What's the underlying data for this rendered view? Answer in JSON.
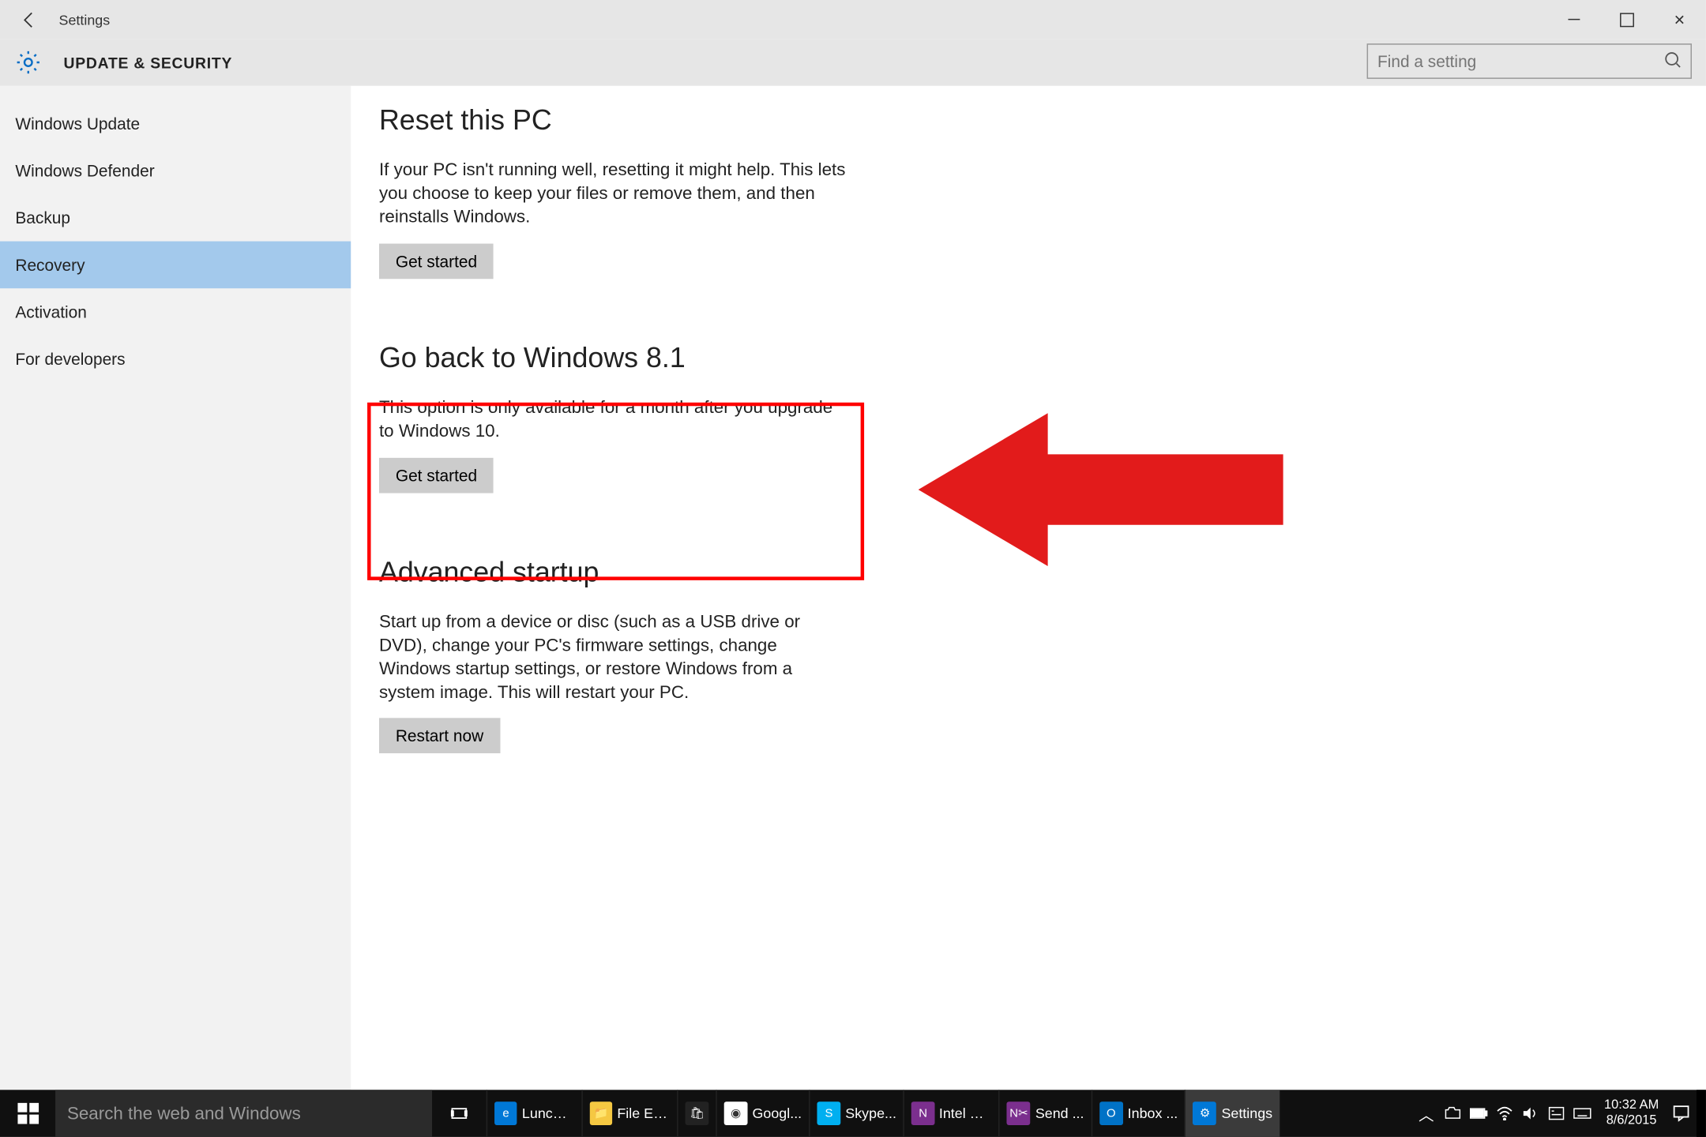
{
  "window": {
    "title": "Settings",
    "section": "UPDATE & SECURITY"
  },
  "search": {
    "placeholder": "Find a setting"
  },
  "sidebar": {
    "items": [
      {
        "label": "Windows Update",
        "active": false
      },
      {
        "label": "Windows Defender",
        "active": false
      },
      {
        "label": "Backup",
        "active": false
      },
      {
        "label": "Recovery",
        "active": true
      },
      {
        "label": "Activation",
        "active": false
      },
      {
        "label": "For developers",
        "active": false
      }
    ]
  },
  "content": {
    "reset": {
      "title": "Reset this PC",
      "body": "If your PC isn't running well, resetting it might help. This lets you choose to keep your files or remove them, and then reinstalls Windows.",
      "button": "Get started"
    },
    "goback": {
      "title": "Go back to Windows 8.1",
      "body": "This option is only available for a month after you upgrade to Windows 10.",
      "button": "Get started"
    },
    "advanced": {
      "title": "Advanced startup",
      "body": "Start up from a device or disc (such as a USB drive or DVD), change your PC's firmware settings, change Windows startup settings, or restore Windows from a system image. This will restart your PC.",
      "button": "Restart now"
    }
  },
  "taskbar": {
    "search_placeholder": "Search the web and Windows",
    "apps": [
      {
        "label": "Lunch ...",
        "bg": "#0078d7",
        "glyph": "e"
      },
      {
        "label": "File Ex...",
        "bg": "#f5c842",
        "glyph": "📁"
      },
      {
        "label": "",
        "bg": "#222",
        "glyph": "🛍"
      },
      {
        "label": "Googl...",
        "bg": "#fff",
        "glyph": "◉"
      },
      {
        "label": "Skype...",
        "bg": "#00aff0",
        "glyph": "S"
      },
      {
        "label": "Intel Ki...",
        "bg": "#7b2f8e",
        "glyph": "N"
      },
      {
        "label": "Send ...",
        "bg": "#7b2f8e",
        "glyph": "N✂"
      },
      {
        "label": "Inbox ...",
        "bg": "#0072c6",
        "glyph": "O"
      },
      {
        "label": "Settings",
        "bg": "#0078d7",
        "glyph": "⚙",
        "active": true
      }
    ],
    "clock": {
      "time": "10:32 AM",
      "date": "8/6/2015"
    }
  },
  "annotation": {
    "arrow_color": "#e21b1b"
  }
}
